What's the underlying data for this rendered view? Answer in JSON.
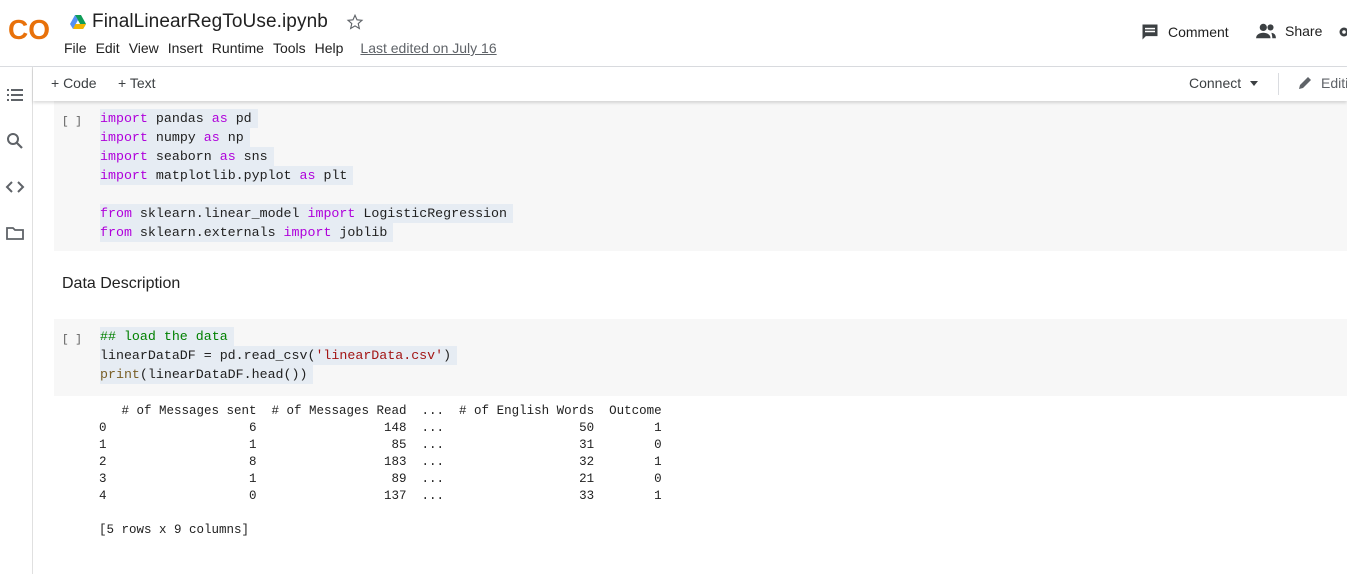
{
  "header": {
    "logo_text": "CO",
    "notebook_title": "FinalLinearRegToUse.ipynb",
    "menu": [
      "File",
      "Edit",
      "View",
      "Insert",
      "Runtime",
      "Tools",
      "Help"
    ],
    "last_edited": "Last edited on July 16",
    "comment_label": "Comment",
    "share_label": "Share"
  },
  "toolbar": {
    "add_code": "+ Code",
    "add_text": "+ Text",
    "connect": "Connect",
    "edit": "Editi"
  },
  "cells": {
    "cell1": {
      "run": "[ ]",
      "lines": [
        [
          [
            "kw",
            "import"
          ],
          [
            "",
            "pandas "
          ],
          [
            "kw",
            "as"
          ],
          [
            "",
            "pd"
          ]
        ],
        [
          [
            "kw",
            "import"
          ],
          [
            "",
            "numpy "
          ],
          [
            "kw",
            "as"
          ],
          [
            "",
            "np"
          ]
        ],
        [
          [
            "kw",
            "import"
          ],
          [
            "",
            "seaborn "
          ],
          [
            "kw",
            "as"
          ],
          [
            "",
            "sns"
          ]
        ],
        [
          [
            "kw",
            "import"
          ],
          [
            "",
            "matplotlib.pyplot "
          ],
          [
            "kw",
            "as"
          ],
          [
            "",
            "plt"
          ]
        ],
        [],
        [
          [
            "kw",
            "from"
          ],
          [
            "",
            "sklearn.linear_model "
          ],
          [
            "kw",
            "import"
          ],
          [
            "",
            "LogisticRegression"
          ]
        ],
        [
          [
            "kw",
            "from"
          ],
          [
            "",
            "sklearn.externals "
          ],
          [
            "kw",
            "import"
          ],
          [
            "",
            "joblib"
          ]
        ]
      ]
    },
    "text_cell": "Data Description",
    "cell2": {
      "run": "[ ]",
      "lines": [
        [
          [
            "cm",
            "## load the data"
          ]
        ],
        [
          [
            "",
            "linearDataDF = pd.read_csv("
          ],
          [
            "st",
            "'linearData.csv'"
          ],
          [
            "",
            ")"
          ]
        ],
        [
          [
            "fn",
            "print"
          ],
          [
            "",
            "(linearDataDF.head())"
          ]
        ]
      ]
    },
    "output": "   # of Messages sent  # of Messages Read  ...  # of English Words  Outcome\n0                   6                 148  ...                  50        1\n1                   1                  85  ...                  31        0\n2                   8                 183  ...                  32        1\n3                   1                  89  ...                  21        0\n4                   0                 137  ...                  33        1\n\n[5 rows x 9 columns]"
  },
  "colors": {
    "keyword": "#af00db",
    "comment": "#008000",
    "string": "#a31515",
    "logo_orange": "#f9ab00",
    "logo_orange_dark": "#e8710a"
  },
  "icons": [
    "drive-icon",
    "star-icon",
    "comment-icon",
    "share-icon",
    "toc-icon",
    "search-icon",
    "code-snippets-icon",
    "files-icon",
    "dropdown-icon",
    "pencil-icon"
  ]
}
